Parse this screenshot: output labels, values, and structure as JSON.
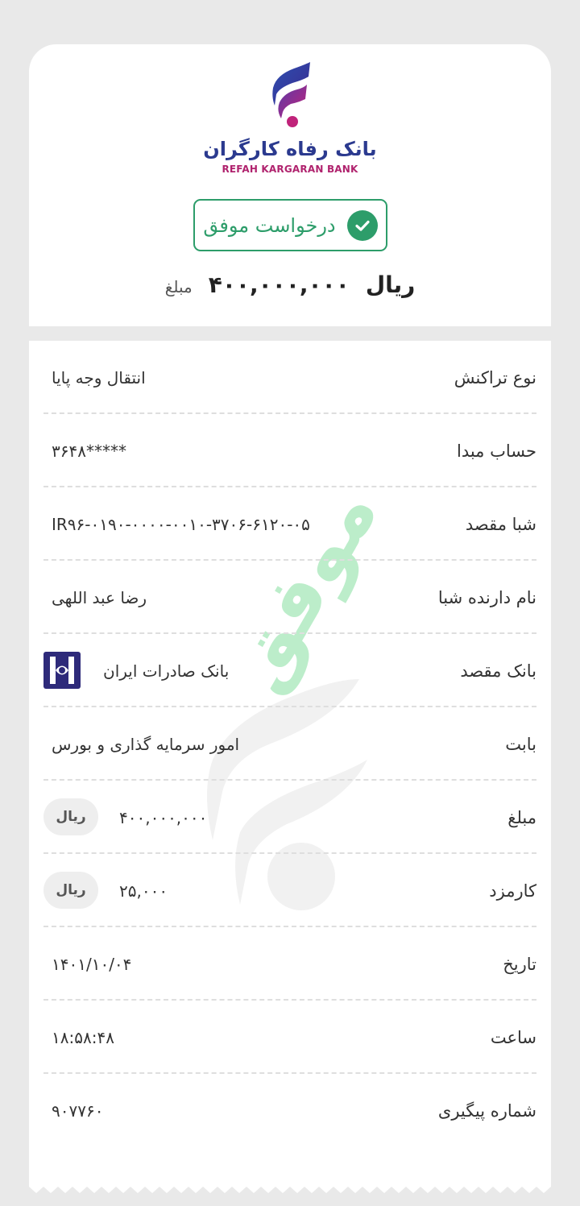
{
  "colors": {
    "success": "#2d9d6a",
    "brand_blue": "#2b3a8f",
    "brand_magenta": "#b0236e",
    "background": "#e9e9e9"
  },
  "header": {
    "logo_fa": "بانک رفاه کارگران",
    "logo_en": "REFAH KARGARAN BANK",
    "status_text": "درخواست موفق",
    "status_icon": "check-circle-icon",
    "amount_label": "مبلغ",
    "amount_value": "۴۰۰,۰۰۰,۰۰۰",
    "amount_currency": "ریال"
  },
  "watermark_text": "موفق",
  "details": [
    {
      "label": "نوع تراکنش",
      "value": "انتقال وجه پایا"
    },
    {
      "label": "حساب مبدا",
      "value": "*****۳۶۴۸"
    },
    {
      "label": "شبا مقصد",
      "value": "IR۹۶-۰۱۹۰-۰۰۰۰-۰۰۱۰-۳۷۰۶-۶۱۲۰-۰۵"
    },
    {
      "label": "نام دارنده شبا",
      "value": "رضا عبد اللهی"
    },
    {
      "label": "بانک مقصد",
      "value": "بانک صادرات ایران",
      "icon": "bank-saderat-logo-icon"
    },
    {
      "label": "بابت",
      "value": "امور سرمایه گذاری و بورس"
    },
    {
      "label": "مبلغ",
      "value": "۴۰۰,۰۰۰,۰۰۰",
      "unit": "ریال"
    },
    {
      "label": "کارمزد",
      "value": "۲۵,۰۰۰",
      "unit": "ریال"
    },
    {
      "label": "تاریخ",
      "value": "۱۴۰۱/۱۰/۰۴"
    },
    {
      "label": "ساعت",
      "value": "۱۸:۵۸:۴۸"
    },
    {
      "label": "شماره پیگیری",
      "value": "۹۰۷۷۶۰"
    }
  ]
}
